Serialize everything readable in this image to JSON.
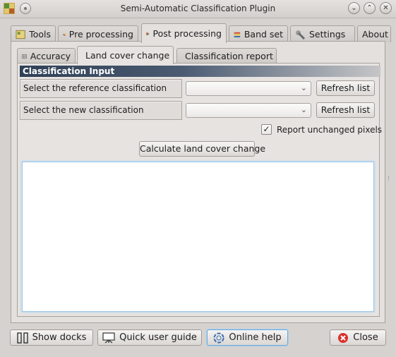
{
  "window": {
    "title": "Semi-Automatic Classification Plugin",
    "controls": {
      "minimize": "⌄",
      "maximize": "⌃",
      "close": "✕"
    }
  },
  "main_tabs": [
    {
      "label": "Tools",
      "icon": "tools-icon"
    },
    {
      "label": "Pre processing",
      "icon": "pre-processing-icon"
    },
    {
      "label": "Post processing",
      "icon": "post-processing-icon",
      "active": true
    },
    {
      "label": "Band set",
      "icon": "band-set-icon"
    },
    {
      "label": "Settings",
      "icon": "wrench-icon"
    },
    {
      "label": "About"
    }
  ],
  "sub_tabs": [
    {
      "label": "Accuracy",
      "icon": "grid-icon"
    },
    {
      "label": "Land cover change",
      "icon": "land-cover-icon",
      "active": true
    },
    {
      "label": "Classification report",
      "icon": "percent-icon"
    }
  ],
  "section": {
    "header": "Classification Input",
    "reference_label": "Select the reference classification",
    "new_label": "Select the new classification",
    "reference_value": "",
    "new_value": "",
    "refresh_label": "Refresh list",
    "report_unchanged_label": "Report unchanged pixels",
    "report_unchanged_checked": true,
    "calculate_label": "Calculate land cover change"
  },
  "bottom_bar": {
    "show_docks": "Show docks",
    "quick_guide": "Quick user guide",
    "online_help": "Online help",
    "close": "Close"
  },
  "colors": {
    "section_header_start": "#2e3f55",
    "focus_border": "#6fa8d8",
    "close_icon": "#d9312b"
  }
}
